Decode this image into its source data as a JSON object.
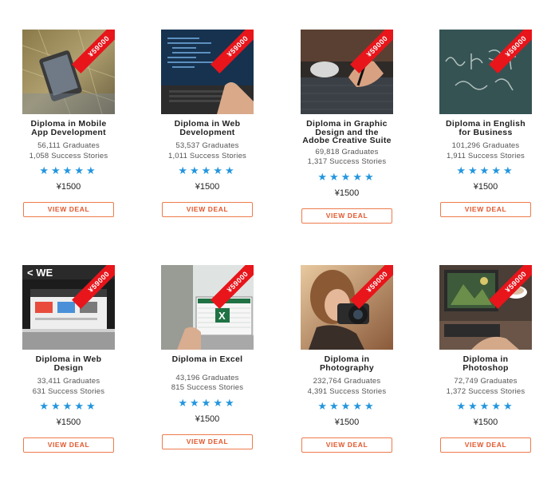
{
  "deals": [
    {
      "title": "Diploma in Mobile App Development",
      "graduates": "56,111 Graduates",
      "stories": "1,058 Success Stories",
      "stars": "★★★★★",
      "price": "¥1500",
      "badge": "¥59000",
      "cta": "VIEW DEAL",
      "image": "mobile-phone-photo"
    },
    {
      "title": "Diploma in Web Development",
      "graduates": "53,537 Graduates",
      "stories": "1,011 Success Stories",
      "stars": "★★★★★",
      "price": "¥1500",
      "badge": "¥59000",
      "cta": "VIEW DEAL",
      "image": "laptop-code-photo"
    },
    {
      "title": "Diploma in Graphic Design and the Adobe Creative Suite",
      "graduates": "69,818 Graduates",
      "stories": "1,317 Success Stories",
      "stars": "★★★★★",
      "price": "¥1500",
      "badge": "¥59000",
      "cta": "VIEW DEAL",
      "image": "drawing-hand-photo"
    },
    {
      "title": "Diploma in English for Business",
      "graduates": "101,296 Graduates",
      "stories": "1,911 Success Stories",
      "stars": "★★★★★",
      "price": "¥1500",
      "badge": "¥59000",
      "cta": "VIEW DEAL",
      "image": "chalkboard-photo"
    },
    {
      "title": "Diploma in Web Design",
      "graduates": "33,411 Graduates",
      "stories": "631 Success Stories",
      "stars": "★★★★★",
      "price": "¥1500",
      "badge": "¥59000",
      "cta": "VIEW DEAL",
      "image": "web-laptop-photo"
    },
    {
      "title": "Diploma in Excel",
      "graduates": "43,196 Graduates",
      "stories": "815 Success Stories",
      "stars": "★★★★★",
      "price": "¥1500",
      "badge": "¥59000",
      "cta": "VIEW DEAL",
      "image": "excel-laptop-photo"
    },
    {
      "title": "Diploma in Photography",
      "graduates": "232,764 Graduates",
      "stories": "4,391 Success Stories",
      "stars": "★★★★★",
      "price": "¥1500",
      "badge": "¥59000",
      "cta": "VIEW DEAL",
      "image": "camera-woman-photo"
    },
    {
      "title": "Diploma in Photoshop",
      "graduates": "72,749 Graduates",
      "stories": "1,372 Success Stories",
      "stars": "★★★★★",
      "price": "¥1500",
      "badge": "¥59000",
      "cta": "VIEW DEAL",
      "image": "photoshop-desk-photo"
    }
  ],
  "colors": {
    "ribbon": "#e8151b",
    "star": "#2396de",
    "button_border": "#ee7b4c",
    "button_text": "#e2572c"
  }
}
